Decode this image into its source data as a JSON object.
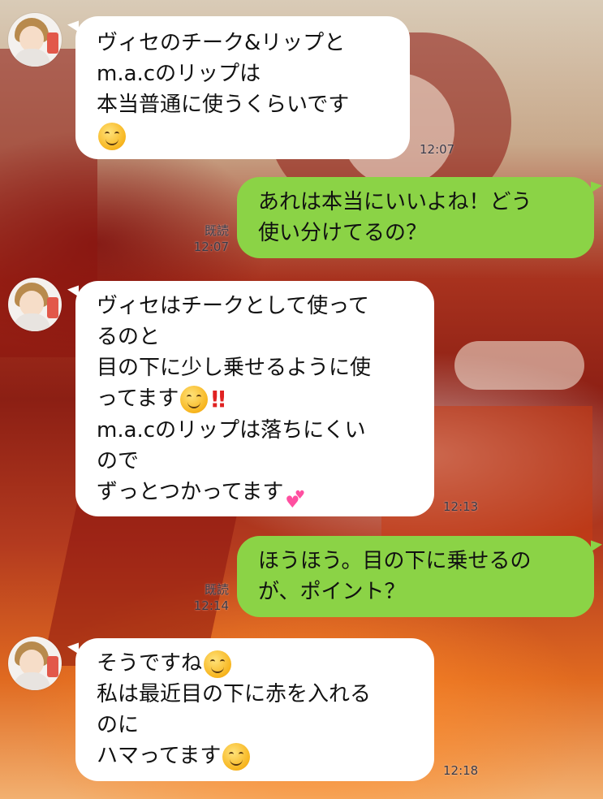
{
  "messages": [
    {
      "side": "in",
      "lines": [
        "ヴィセのチーク&リップと",
        "m.a.cのリップは",
        "本当普通に使うくらいです",
        ""
      ],
      "time": "12:07"
    },
    {
      "side": "out",
      "lines": [
        "あれは本当にいいよね！どう",
        "使い分けてるの？"
      ],
      "read_label": "既読",
      "time": "12:07"
    },
    {
      "side": "in",
      "lines": [
        "ヴィセはチークとして使って",
        "るのと",
        "目の下に少し乗せるように使",
        "ってます",
        "m.a.cのリップは落ちにくい",
        "ので",
        "ずっとつかってます"
      ],
      "time": "12:13"
    },
    {
      "side": "out",
      "lines": [
        "ほうほう。目の下に乗せるの",
        "が、ポイント？"
      ],
      "read_label": "既読",
      "time": "12:14"
    },
    {
      "side": "in",
      "lines": [
        "そうですね",
        "私は最近目の下に赤を入れる",
        "のに",
        "ハマってます"
      ],
      "time": "12:18"
    }
  ],
  "icons": {
    "smile": "smiling-face-emoji",
    "double_exclamation": "double-exclamation-emoji",
    "hearts": "two-hearts-emoji"
  },
  "colors": {
    "incoming_bubble": "#ffffff",
    "outgoing_bubble": "#8bd346",
    "timestamp": "#3a3a48"
  }
}
